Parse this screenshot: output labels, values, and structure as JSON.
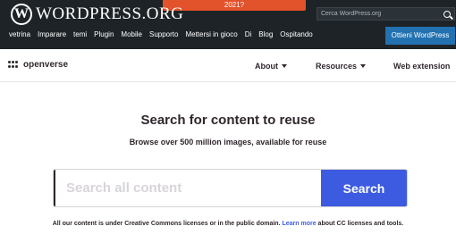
{
  "wp_bar": {
    "logo_mark": "W",
    "logo_text": "WORDPRESS.ORG",
    "banner_text": "2021?",
    "search_placeholder": "Cerca WordPress.org",
    "nav": [
      "vetrina",
      "Imparare",
      "temi",
      "Plugin",
      "Mobile",
      "Supporto",
      "Mettersi in gioco",
      "Di",
      "Blog",
      "Ospitando"
    ],
    "get_button": "Ottieni WordPress",
    "colors": {
      "bar": "#1d2327",
      "banner": "#e2522b",
      "get_button": "#2271b1"
    }
  },
  "openverse": {
    "brand": "openverse",
    "menu": {
      "about": "About",
      "resources": "Resources",
      "extension": "Web extension"
    }
  },
  "main": {
    "headline": "Search for content to reuse",
    "subline": "Browse over 500 million images, available for reuse",
    "search_placeholder": "Search all content",
    "search_button": "Search",
    "license_prefix": "All our content is under Creative Commons licenses or in the public domain.",
    "license_link": "Learn more",
    "license_suffix": "about CC licenses and tools.",
    "colors": {
      "accent": "#3c5be0",
      "text": "#30272e"
    }
  }
}
